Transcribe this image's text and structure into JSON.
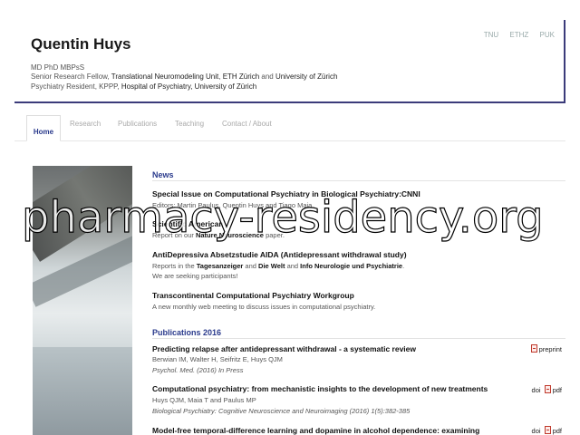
{
  "header": {
    "name": "Quentin Huys",
    "degrees": "MD PhD MBPsS",
    "line2_prefix": "Senior Research Fellow, ",
    "line2_unit": "Translational Neuromodeling Unit",
    "line2_mid": ", ",
    "line2_eth": "ETH Zürich",
    "line2_and": " and ",
    "line2_uzh": "University of Zürich",
    "line3_prefix": "Psychiatry Resident, KPPP, ",
    "line3_hosp": "Hospital of Psychiatry, University of Zürich",
    "toplinks": [
      "TNU",
      "ETHZ",
      "PUK"
    ]
  },
  "nav": {
    "home": "Home",
    "research": "Research",
    "publications": "Publications",
    "teaching": "Teaching",
    "contact": "Contact / About"
  },
  "news": {
    "heading": "News",
    "items": [
      {
        "title": "Special Issue on Computational Psychiatry in Biological Psychiatry:CNNI",
        "line": "Editors: Martin Paulus, Quentin Huys and Tiago Maia"
      },
      {
        "title": "Scientific American",
        "line_prefix": "Report on our ",
        "line_bold": "Nature Neuroscience",
        "line_suffix": " paper."
      },
      {
        "title": "AntiDepressiva Absetzstudie AIDA (Antidepressant withdrawal study)",
        "line_prefix": "Reports in the ",
        "b1": "Tagesanzeiger",
        "and1": " and ",
        "b2": "Die Welt",
        "and2": " and ",
        "b3": "Info Neurologie und Psychiatrie",
        "end": ".",
        "line2": "We are seeking participants!"
      },
      {
        "title": "Transcontinental Computational Psychiatry Workgroup",
        "line": "A new monthly web meeting to discuss issues in computational psychiatry."
      }
    ]
  },
  "pubs": {
    "heading": "Publications 2016",
    "items": [
      {
        "title": "Predicting relapse after antidepressant withdrawal - a systematic review",
        "authors": "Berwian IM, Walter H, Seifritz E, Huys QJM",
        "journal": "Psychol. Med. (2016) In Press",
        "tag": "preprint"
      },
      {
        "title": "Computational psychiatry: from mechanistic insights to the development of new treatments",
        "authors": "Huys QJM, Maia T and Paulus MP",
        "journal": "Biological Psychiatry: Cognitive Neuroscience and Neuroimaging (2016) 1(5):382-385",
        "doi": "doi",
        "tag": "pdf"
      },
      {
        "title": "Model-free temporal-difference learning and dopamine in alcohol dependence: examining",
        "doi": "doi",
        "tag": "pdf"
      }
    ]
  },
  "watermark": "pharmacy-residency.org"
}
